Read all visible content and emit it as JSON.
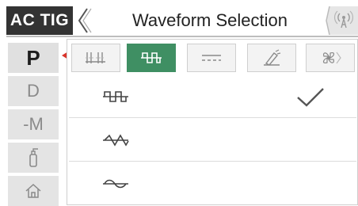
{
  "header": {
    "mode_label": "AC TIG",
    "title": "Waveform Selection",
    "back_icon": "chevron-left-icon",
    "wireless_icon": "wireless-antenna-icon"
  },
  "sidebar": {
    "items": [
      {
        "label": "P",
        "active": true
      },
      {
        "label": "D",
        "active": false
      },
      {
        "label": "-M",
        "active": false
      },
      {
        "icon": "gas-cylinder-icon",
        "active": false
      },
      {
        "icon": "home-icon",
        "active": false
      }
    ],
    "active_marker_color": "#d9342b"
  },
  "tabs": [
    {
      "icon": "pulse-parameters-icon",
      "active": false
    },
    {
      "icon": "square-waveform-icon",
      "active": true
    },
    {
      "icon": "dc-line-icon",
      "active": false
    },
    {
      "icon": "torch-welding-icon",
      "active": false
    },
    {
      "icon": "fan-cooling-icon",
      "active": false
    }
  ],
  "waveforms": [
    {
      "icon": "square-wave-icon",
      "selected": true
    },
    {
      "icon": "triangle-wave-icon",
      "selected": false
    },
    {
      "icon": "sine-wave-icon",
      "selected": false
    }
  ],
  "colors": {
    "accent": "#3f8f63",
    "header_bg": "#333333"
  }
}
